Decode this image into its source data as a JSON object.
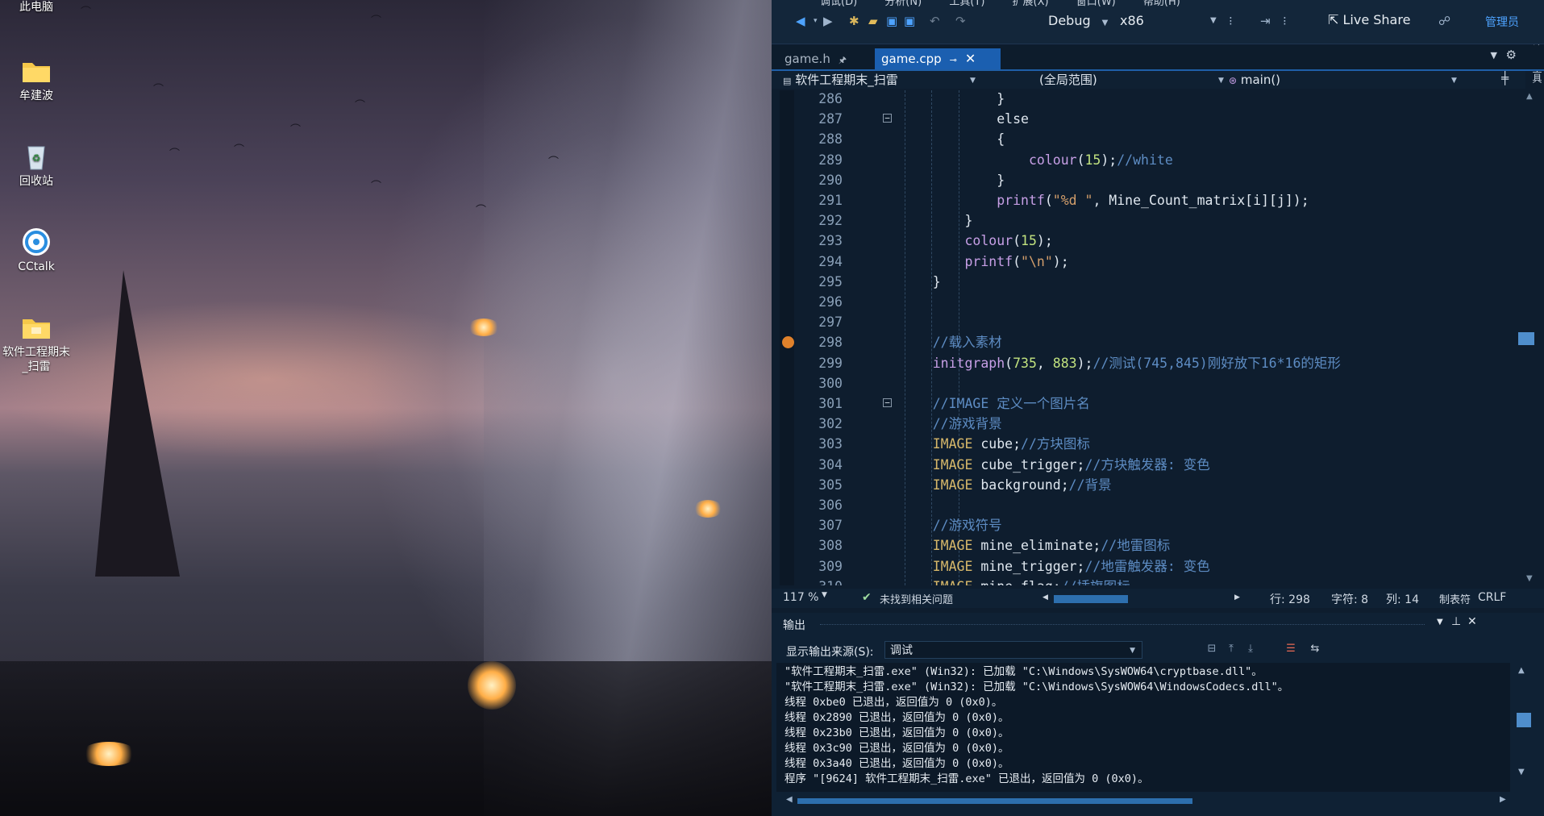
{
  "desktop": {
    "icons": [
      {
        "label": "此电脑",
        "icon": "computer-icon"
      },
      {
        "label": "牟建波",
        "icon": "folder-icon"
      },
      {
        "label": "回收站",
        "icon": "recycle-bin-icon"
      },
      {
        "label": "CCtalk",
        "icon": "cctalk-icon"
      },
      {
        "label": "软件工程期末_扫雷",
        "icon": "folder-icon"
      }
    ]
  },
  "vs": {
    "menu": [
      "调试(D)",
      "分析(N)",
      "工具(T)",
      "扩展(X)",
      "窗口(W)",
      "帮助(H)"
    ],
    "toolbar": {
      "config": "Debug",
      "platform": "x86",
      "live_share": "Live Share",
      "admin": "管理员"
    },
    "tabs": [
      {
        "label": "game.h",
        "active": false
      },
      {
        "label": "game.cpp",
        "active": true
      }
    ],
    "nav": {
      "project": "软件工程期末_扫雷",
      "scope": "(全局范围)",
      "member": "main()"
    },
    "right_rail_label": "诊断工具",
    "code_lines": [
      {
        "n": "286",
        "tokens": [
          {
            "t": "            }",
            "c": "plain"
          }
        ]
      },
      {
        "n": "287",
        "fold": "−",
        "tokens": [
          {
            "t": "            else",
            "c": "plain"
          }
        ]
      },
      {
        "n": "288",
        "tokens": [
          {
            "t": "            {",
            "c": "plain"
          }
        ]
      },
      {
        "n": "289",
        "tokens": [
          {
            "t": "                ",
            "c": "plain"
          },
          {
            "t": "colour",
            "c": "fn"
          },
          {
            "t": "(",
            "c": "plain"
          },
          {
            "t": "15",
            "c": "num"
          },
          {
            "t": ");",
            "c": "plain"
          },
          {
            "t": "//white",
            "c": "cm"
          }
        ]
      },
      {
        "n": "290",
        "tokens": [
          {
            "t": "            }",
            "c": "plain"
          }
        ]
      },
      {
        "n": "291",
        "tokens": [
          {
            "t": "            ",
            "c": "plain"
          },
          {
            "t": "printf",
            "c": "fn"
          },
          {
            "t": "(",
            "c": "plain"
          },
          {
            "t": "\"%d \"",
            "c": "str"
          },
          {
            "t": ", Mine_Count_matrix[i][j]);",
            "c": "plain"
          }
        ]
      },
      {
        "n": "292",
        "tokens": [
          {
            "t": "        }",
            "c": "plain"
          }
        ]
      },
      {
        "n": "293",
        "tokens": [
          {
            "t": "        ",
            "c": "plain"
          },
          {
            "t": "colour",
            "c": "fn"
          },
          {
            "t": "(",
            "c": "plain"
          },
          {
            "t": "15",
            "c": "num"
          },
          {
            "t": ");",
            "c": "plain"
          }
        ]
      },
      {
        "n": "294",
        "tokens": [
          {
            "t": "        ",
            "c": "plain"
          },
          {
            "t": "printf",
            "c": "fn"
          },
          {
            "t": "(",
            "c": "plain"
          },
          {
            "t": "\"\\n\"",
            "c": "str"
          },
          {
            "t": ");",
            "c": "plain"
          }
        ]
      },
      {
        "n": "295",
        "tokens": [
          {
            "t": "    }",
            "c": "plain"
          }
        ]
      },
      {
        "n": "296",
        "tokens": []
      },
      {
        "n": "297",
        "tokens": []
      },
      {
        "n": "298",
        "bp": true,
        "tokens": [
          {
            "t": "    ",
            "c": "plain"
          },
          {
            "t": "//载入素材",
            "c": "cm"
          }
        ]
      },
      {
        "n": "299",
        "tokens": [
          {
            "t": "    ",
            "c": "plain"
          },
          {
            "t": "initgraph",
            "c": "fn"
          },
          {
            "t": "(",
            "c": "plain"
          },
          {
            "t": "735",
            "c": "num"
          },
          {
            "t": ", ",
            "c": "plain"
          },
          {
            "t": "883",
            "c": "num"
          },
          {
            "t": ");",
            "c": "plain"
          },
          {
            "t": "//测试(745,845)刚好放下16*16的矩形",
            "c": "cm"
          }
        ]
      },
      {
        "n": "300",
        "tokens": []
      },
      {
        "n": "301",
        "fold": "−",
        "tokens": [
          {
            "t": "    ",
            "c": "plain"
          },
          {
            "t": "//IMAGE 定义一个图片名",
            "c": "cm"
          }
        ]
      },
      {
        "n": "302",
        "tokens": [
          {
            "t": "    ",
            "c": "plain"
          },
          {
            "t": "//游戏背景",
            "c": "cm"
          }
        ]
      },
      {
        "n": "303",
        "tokens": [
          {
            "t": "    ",
            "c": "plain"
          },
          {
            "t": "IMAGE",
            "c": "type"
          },
          {
            "t": " cube;",
            "c": "plain"
          },
          {
            "t": "//方块图标",
            "c": "cm"
          }
        ]
      },
      {
        "n": "304",
        "tokens": [
          {
            "t": "    ",
            "c": "plain"
          },
          {
            "t": "IMAGE",
            "c": "type"
          },
          {
            "t": " cube_trigger;",
            "c": "plain"
          },
          {
            "t": "//方块触发器: 变色",
            "c": "cm"
          }
        ]
      },
      {
        "n": "305",
        "tokens": [
          {
            "t": "    ",
            "c": "plain"
          },
          {
            "t": "IMAGE",
            "c": "type"
          },
          {
            "t": " background;",
            "c": "plain"
          },
          {
            "t": "//背景",
            "c": "cm"
          }
        ]
      },
      {
        "n": "306",
        "tokens": []
      },
      {
        "n": "307",
        "tokens": [
          {
            "t": "    ",
            "c": "plain"
          },
          {
            "t": "//游戏符号",
            "c": "cm"
          }
        ]
      },
      {
        "n": "308",
        "tokens": [
          {
            "t": "    ",
            "c": "plain"
          },
          {
            "t": "IMAGE",
            "c": "type"
          },
          {
            "t": " mine_eliminate;",
            "c": "plain"
          },
          {
            "t": "//地雷图标",
            "c": "cm"
          }
        ]
      },
      {
        "n": "309",
        "tokens": [
          {
            "t": "    ",
            "c": "plain"
          },
          {
            "t": "IMAGE",
            "c": "type"
          },
          {
            "t": " mine_trigger;",
            "c": "plain"
          },
          {
            "t": "//地雷触发器: 变色",
            "c": "cm"
          }
        ]
      },
      {
        "n": "310",
        "tokens": [
          {
            "t": "    ",
            "c": "plain"
          },
          {
            "t": "IMAGE",
            "c": "type"
          },
          {
            "t": " mine_flag;",
            "c": "plain"
          },
          {
            "t": "//插旗图标",
            "c": "cm"
          }
        ]
      }
    ],
    "status": {
      "zoom": "117 %",
      "issues": "未找到相关问题",
      "line": "行: 298",
      "char": "字符: 8",
      "col": "列: 14",
      "tabs": "制表符",
      "eol": "CRLF"
    },
    "output": {
      "title": "输出",
      "source_label": "显示输出来源(S):",
      "source_value": "调试",
      "lines": [
        "\"软件工程期末_扫雷.exe\" (Win32): 已加载 \"C:\\Windows\\SysWOW64\\cryptbase.dll\"。",
        "\"软件工程期末_扫雷.exe\" (Win32): 已加载 \"C:\\Windows\\SysWOW64\\WindowsCodecs.dll\"。",
        "线程 0xbe0 已退出，返回值为 0 (0x0)。",
        "线程 0x2890 已退出，返回值为 0 (0x0)。",
        "线程 0x23b0 已退出，返回值为 0 (0x0)。",
        "线程 0x3c90 已退出，返回值为 0 (0x0)。",
        "线程 0x3a40 已退出，返回值为 0 (0x0)。",
        "程序 \"[9624] 软件工程期末_扫雷.exe\" 已退出，返回值为 0 (0x0)。"
      ]
    }
  }
}
